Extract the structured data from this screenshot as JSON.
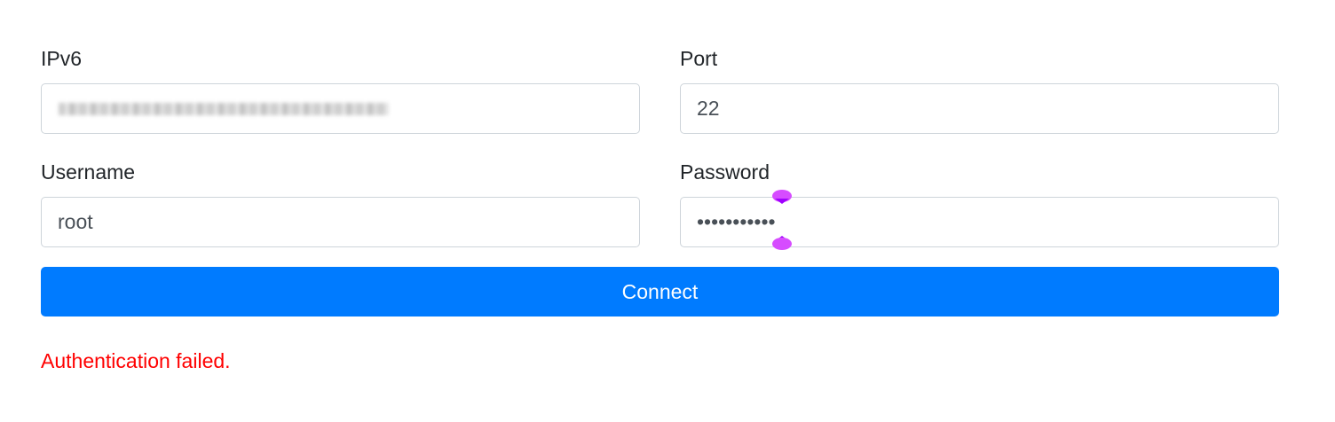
{
  "fields": {
    "ipv6": {
      "label": "IPv6",
      "value": ""
    },
    "port": {
      "label": "Port",
      "value": "22"
    },
    "username": {
      "label": "Username",
      "value": "root"
    },
    "password": {
      "label": "Password",
      "value": "•••••••••••"
    }
  },
  "actions": {
    "connect_label": "Connect"
  },
  "status": {
    "error_text": "Authentication failed."
  },
  "colors": {
    "primary": "#007bff",
    "error": "#ff0000",
    "caret_marker": "#d64cff"
  },
  "icons": {
    "caret_top": "selection-handle-top-icon",
    "caret_bottom": "selection-handle-bottom-icon"
  }
}
